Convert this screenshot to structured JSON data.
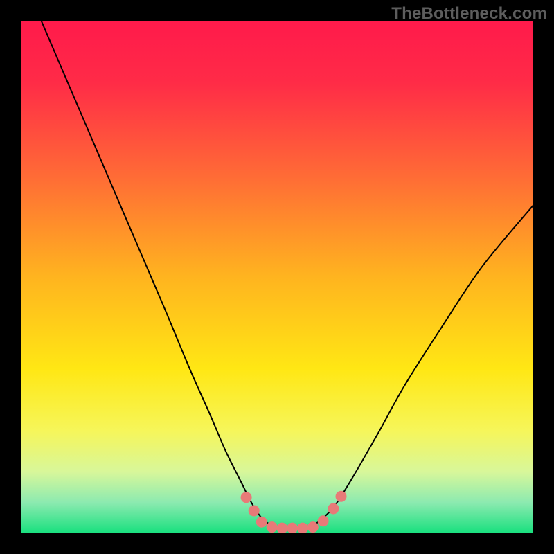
{
  "watermark": "TheBottleneck.com",
  "chart_data": {
    "type": "line",
    "title": "",
    "xlabel": "",
    "ylabel": "",
    "xlim": [
      0,
      100
    ],
    "ylim": [
      0,
      100
    ],
    "background_gradient": {
      "stops": [
        {
          "offset": 0.0,
          "color": "#ff1a4b"
        },
        {
          "offset": 0.12,
          "color": "#ff2b47"
        },
        {
          "offset": 0.3,
          "color": "#ff6a36"
        },
        {
          "offset": 0.5,
          "color": "#ffb41f"
        },
        {
          "offset": 0.68,
          "color": "#ffe714"
        },
        {
          "offset": 0.8,
          "color": "#f6f65a"
        },
        {
          "offset": 0.88,
          "color": "#d8f79a"
        },
        {
          "offset": 0.94,
          "color": "#8ceab0"
        },
        {
          "offset": 1.0,
          "color": "#18e07e"
        }
      ]
    },
    "series": [
      {
        "name": "bottleneck-curve",
        "color": "#000000",
        "stroke_width": 2,
        "x": [
          4,
          10,
          16,
          22,
          28,
          33,
          37,
          40,
          43,
          45,
          47,
          49,
          51,
          53,
          55,
          57,
          59,
          61,
          63,
          66,
          70,
          75,
          82,
          90,
          100
        ],
        "y": [
          100,
          86,
          72,
          58,
          44,
          32,
          23,
          16,
          10,
          6,
          3,
          1.5,
          1,
          1,
          1,
          1.5,
          3,
          5,
          8,
          13,
          20,
          29,
          40,
          52,
          64
        ]
      }
    ],
    "markers": {
      "name": "highlight-points",
      "color": "#e77a78",
      "radius": 8,
      "points": [
        {
          "x": 44,
          "y": 7
        },
        {
          "x": 45.5,
          "y": 4.4
        },
        {
          "x": 47,
          "y": 2.2
        },
        {
          "x": 49,
          "y": 1.2
        },
        {
          "x": 51,
          "y": 1.0
        },
        {
          "x": 53,
          "y": 1.0
        },
        {
          "x": 55,
          "y": 1.0
        },
        {
          "x": 57,
          "y": 1.2
        },
        {
          "x": 59,
          "y": 2.4
        },
        {
          "x": 61,
          "y": 4.8
        },
        {
          "x": 62.5,
          "y": 7.2
        }
      ]
    }
  }
}
